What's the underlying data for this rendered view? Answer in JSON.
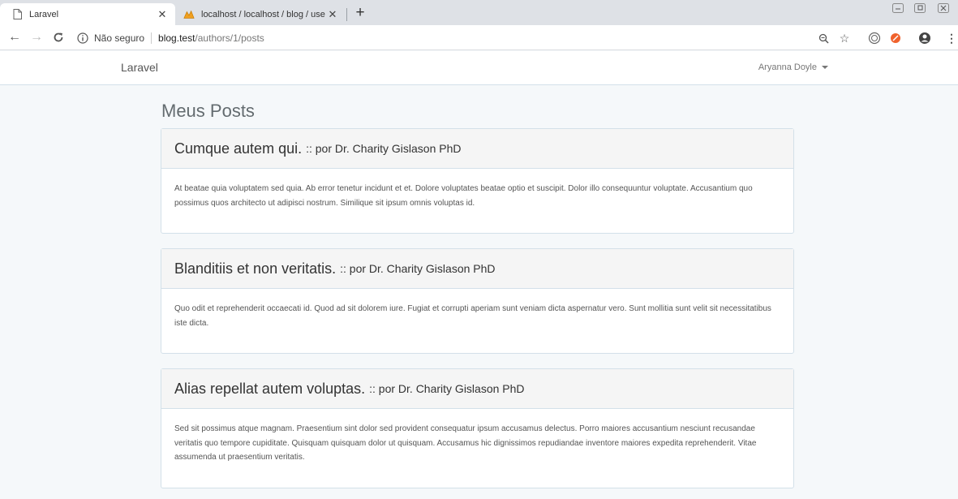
{
  "browser": {
    "tabs": [
      {
        "title": "Laravel",
        "favicon": "page-icon"
      },
      {
        "title": "localhost / localhost / blog / use",
        "favicon": "phpmyadmin-icon"
      }
    ],
    "address": {
      "security": "Não seguro",
      "host": "blog.test",
      "path": "/authors/1/posts"
    }
  },
  "navbar": {
    "brand": "Laravel",
    "user": "Aryanna Doyle"
  },
  "page": {
    "heading": "Meus Posts"
  },
  "posts": [
    {
      "title": "Cumque autem qui.",
      "author": ":: por Dr. Charity Gislason PhD",
      "body": "At beatae quia voluptatem sed quia. Ab error tenetur incidunt et et. Dolore voluptates beatae optio et suscipit. Dolor illo consequuntur voluptate. Accusantium quo possimus quos architecto ut adipisci nostrum. Similique sit ipsum omnis voluptas id."
    },
    {
      "title": "Blanditiis et non veritatis.",
      "author": ":: por Dr. Charity Gislason PhD",
      "body": "Quo odit et reprehenderit occaecati id. Quod ad sit dolorem iure. Fugiat et corrupti aperiam sunt veniam dicta aspernatur vero. Sunt mollitia sunt velit sit necessitatibus iste dicta."
    },
    {
      "title": "Alias repellat autem voluptas.",
      "author": ":: por Dr. Charity Gislason PhD",
      "body": "Sed sit possimus atque magnam. Praesentium sint dolor sed provident consequatur ipsum accusamus delectus. Porro maiores accusantium nesciunt recusandae veritatis quo tempore cupiditate. Quisquam quisquam dolor ut quisquam. Accusamus hic dignissimos repudiandae inventore maiores expedita reprehenderit. Vitae assumenda ut praesentium veritatis."
    }
  ]
}
